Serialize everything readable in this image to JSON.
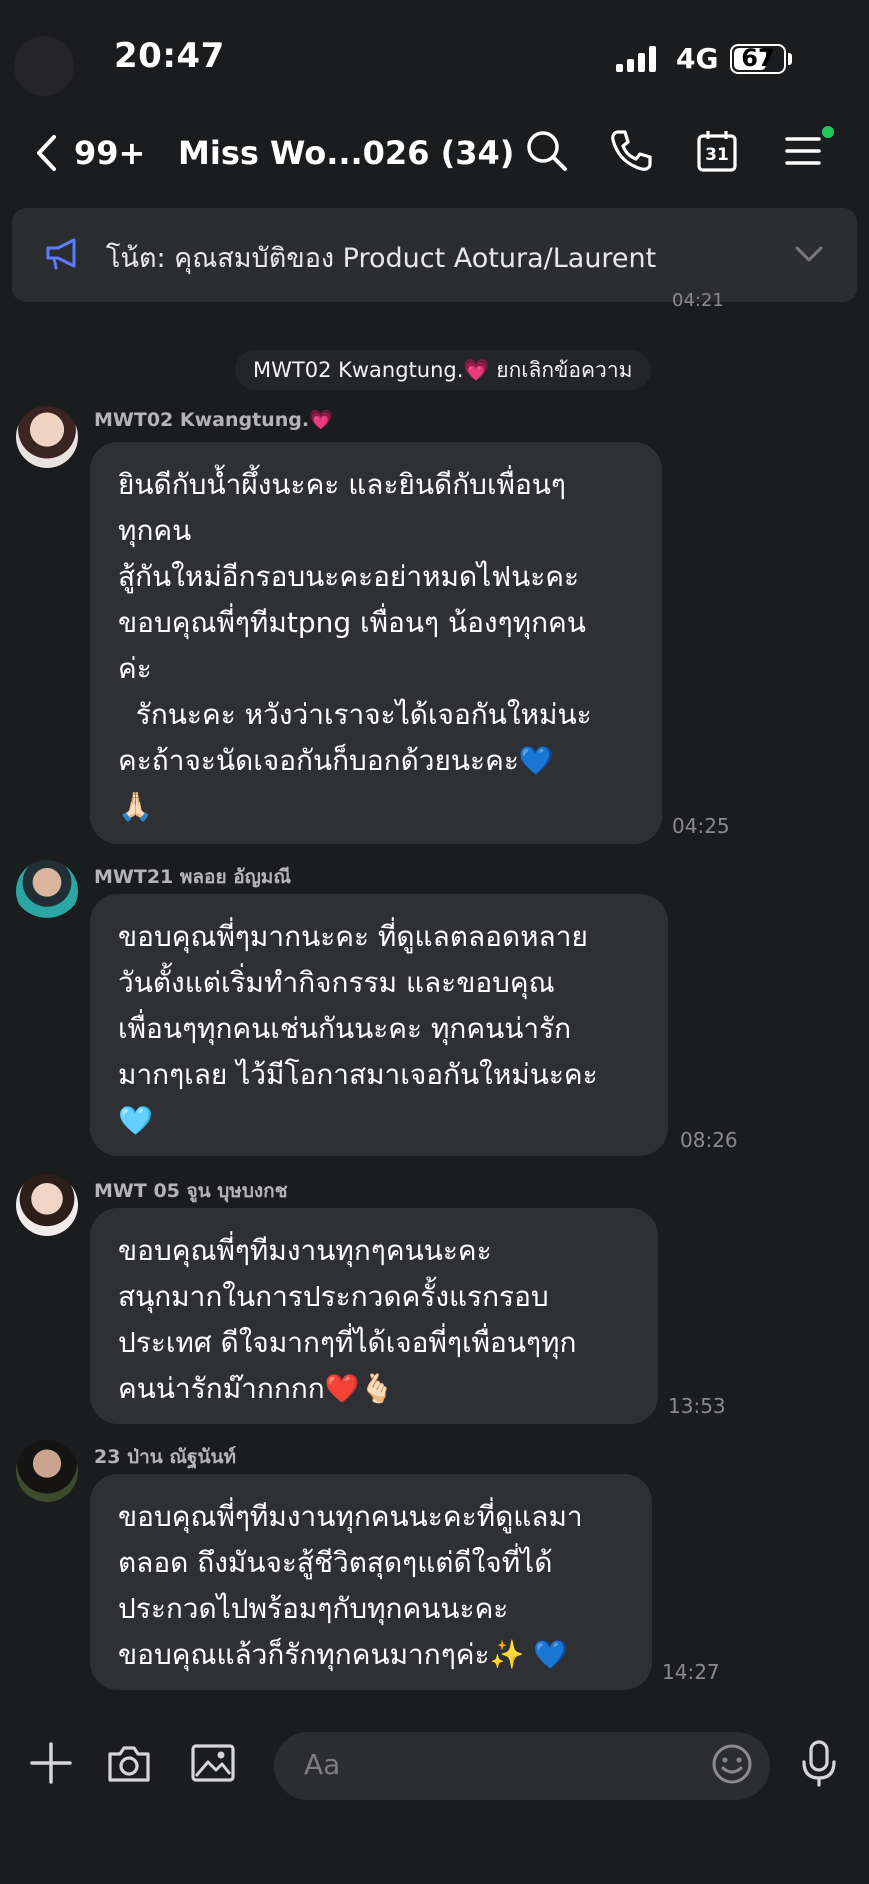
{
  "status_bar": {
    "time": "20:47",
    "network": "4G",
    "battery": "67",
    "battery_level": 0.67
  },
  "header": {
    "unread_count": "99+",
    "title": "Miss Wo...026 (34)",
    "icons": [
      "back-chevron-icon",
      "search-icon",
      "phone-icon",
      "calendar-icon",
      "menu-icon"
    ],
    "calendar_day": "31",
    "calendar_badge_color": "#21c75a"
  },
  "notice": {
    "text": "โน้ต: คุณสมบัติของ Product Aotura/Laurent",
    "icon": "megaphone-icon",
    "hidden_time": "04:21"
  },
  "system_message": {
    "name": "MWT02 Kwangtung.",
    "emoji": "💗",
    "text": "ยกเลิกข้อความ"
  },
  "messages": [
    {
      "sender": "MWT02 Kwangtung.",
      "sender_emoji": "💗",
      "lines": [
        "ยินดีกับน้ำผึ้งนะคะ และยินดีกับเพื่อนๆ",
        "ทุกคน",
        "สู้กันใหม่อีกรอบนะคะอย่าหมดไฟนะคะ",
        "ขอบคุณพี่ๆทีมtpng เพื่อนๆ น้องๆทุกคน",
        "ค่ะ",
        "  รักนะคะ หวังว่าเราจะได้เจอกันใหม่นะ",
        "คะถ้าจะนัดเจอกันก็บอกด้วยนะคะ💙",
        "🙏🏻"
      ],
      "time": "04:25"
    },
    {
      "sender": "MWT21 พลอย อัญมณี",
      "lines": [
        "ขอบคุณพี่ๆมากนะคะ ที่ดูแลตลอดหลาย",
        "วันตั้งแต่เริ่มทำกิจกรรม และขอบคุณ",
        "เพื่อนๆทุกคนเช่นกันนะคะ ทุกคนน่ารัก",
        "มากๆเลย ไว้มีโอกาสมาเจอกันใหม่นะคะ",
        "🩵"
      ],
      "time": "08:26"
    },
    {
      "sender": "MWT 05 จูน บุษบงกช",
      "lines": [
        "ขอบคุณพี่ๆทีมงานทุกๆคนนะคะ",
        "สนุกมากในการประกวดครั้งแรกรอบ",
        "ประเทศ ดีใจมากๆที่ได้เจอพี่ๆเพื่อนๆทุก",
        "คนน่ารักม๊ากกกก❤️🫰🏻"
      ],
      "time": "13:53"
    },
    {
      "sender": "23 ป่าน ณัฐนันท์",
      "lines": [
        "ขอบคุณพี่ๆทีมงานทุกคนนะคะที่ดูแลมา",
        "ตลอด ถึงมันจะสู้ชีวิตสุดๆแต่ดีใจที่ได้",
        "ประกวดไปพร้อมๆกับทุกคนนะคะ",
        "ขอบคุณแล้วก็รักทุกคนมากๆค่ะ✨ 💙"
      ],
      "time": "14:27"
    }
  ],
  "composer": {
    "placeholder": "Aa",
    "icons": [
      "plus-icon",
      "camera-icon",
      "image-icon",
      "emoji-icon",
      "microphone-icon"
    ]
  }
}
